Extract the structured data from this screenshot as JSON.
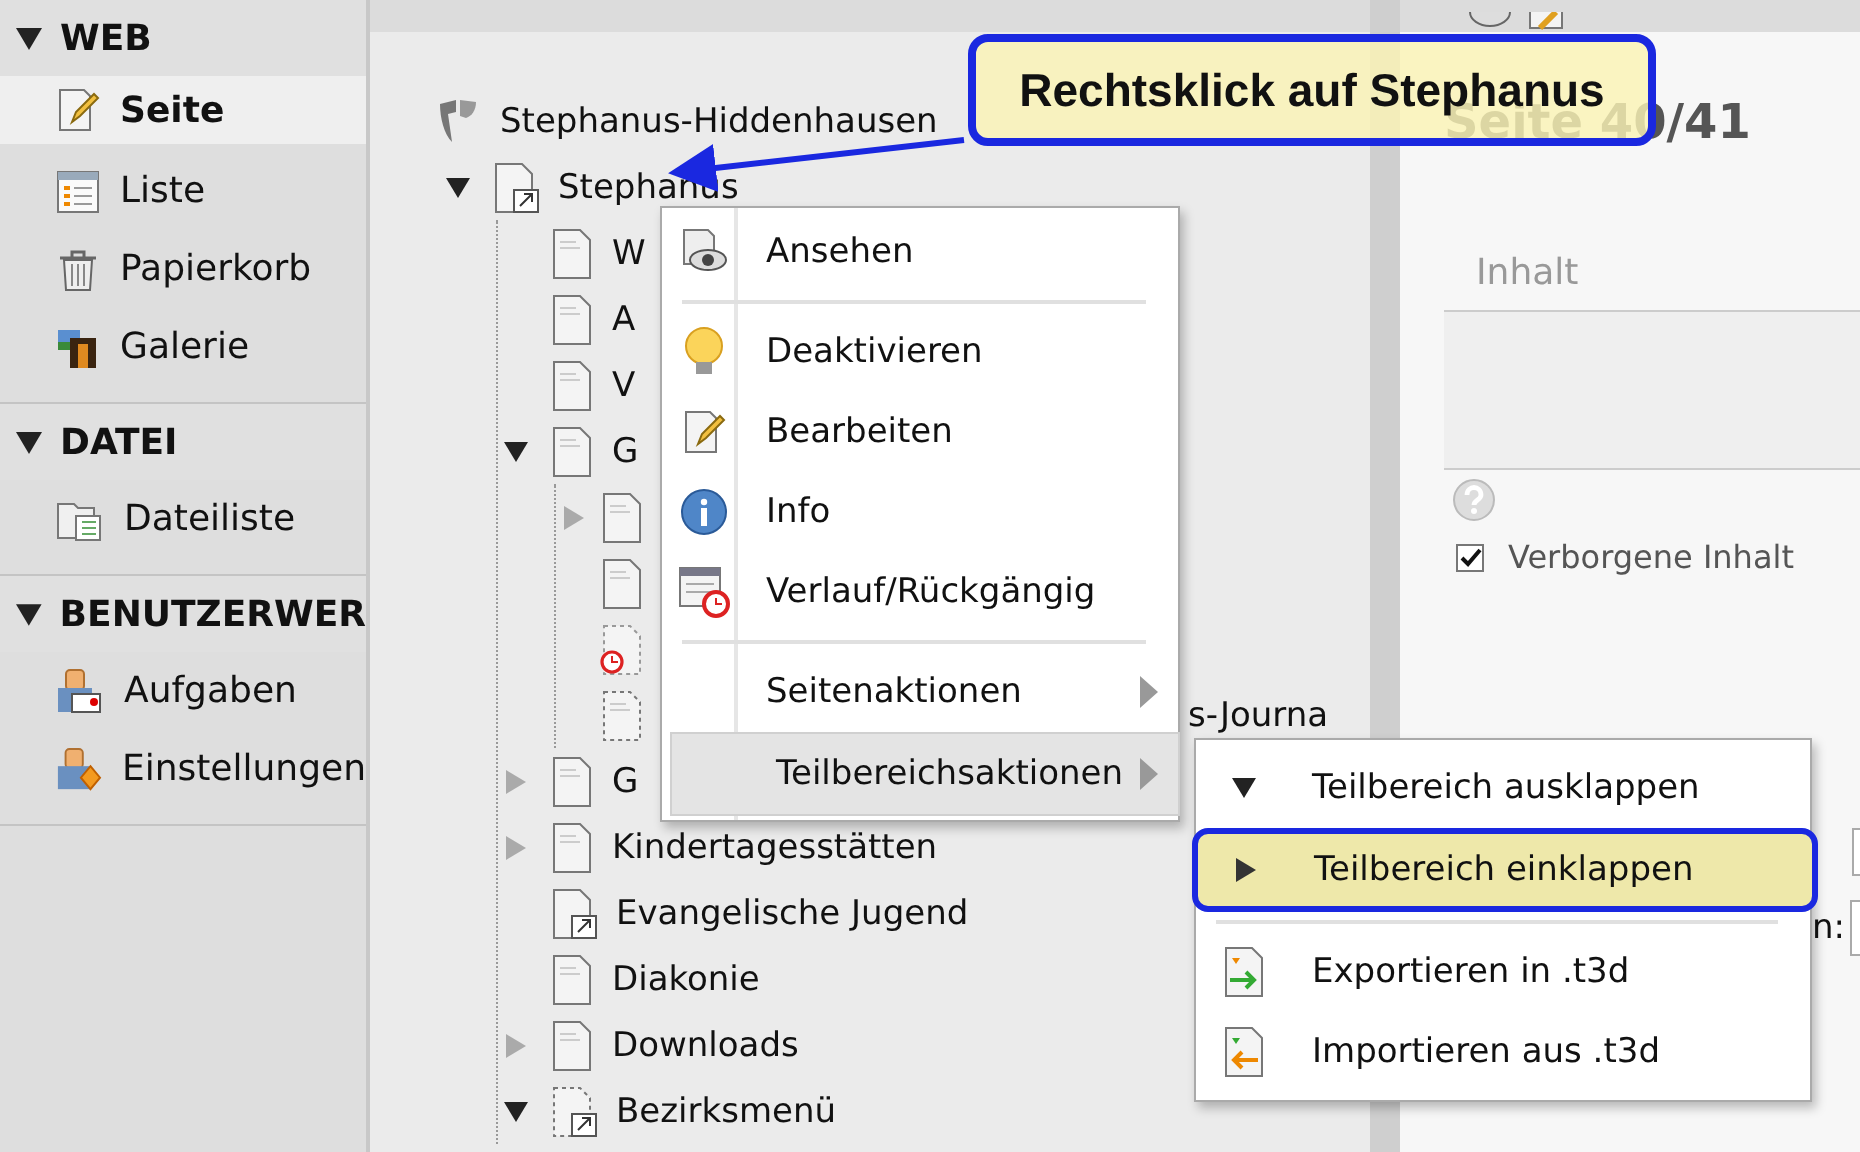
{
  "sidebar": {
    "groups": [
      {
        "title": "WEB",
        "expanded": true,
        "items": [
          {
            "label": "Seite",
            "selected": true
          },
          {
            "label": "Liste",
            "selected": false
          },
          {
            "label": "Papierkorb",
            "selected": false
          },
          {
            "label": "Galerie",
            "selected": false
          }
        ]
      },
      {
        "title": "DATEI",
        "expanded": true,
        "items": [
          {
            "label": "Dateiliste",
            "selected": false
          }
        ]
      },
      {
        "title": "BENUTZERWER",
        "expanded": true,
        "items": [
          {
            "label": "Aufgaben",
            "selected": false
          },
          {
            "label": "Einstellungen",
            "selected": false
          }
        ]
      }
    ]
  },
  "tree": {
    "root": "Stephanus-Hiddenhausen",
    "nodes": [
      {
        "label": "Stephanus",
        "kind": "shortcut",
        "expanded": true,
        "children": [
          {
            "label": "W",
            "kind": "page"
          },
          {
            "label": "A",
            "kind": "page"
          },
          {
            "label": "V",
            "kind": "page"
          },
          {
            "label": "G",
            "kind": "page",
            "expanded": true,
            "children": [
              {
                "kind": "page",
                "expanded": false
              },
              {
                "kind": "page"
              },
              {
                "kind": "scheduled"
              },
              {
                "label": "s-Journa",
                "kind": "hidden"
              }
            ]
          },
          {
            "label": "G",
            "kind": "page",
            "expanded": false
          },
          {
            "label": "Kindertagesstätten",
            "kind": "page",
            "expanded": false
          },
          {
            "label": "Evangelische Jugend",
            "kind": "shortcut"
          },
          {
            "label": "Diakonie",
            "kind": "page"
          },
          {
            "label": "Downloads",
            "kind": "page",
            "expanded": false
          },
          {
            "label": "Bezirksmenü",
            "kind": "hidden-shortcut",
            "expanded": true
          }
        ]
      }
    ]
  },
  "context_menu": {
    "items": [
      {
        "kind": "item",
        "label": "Ansehen",
        "selected": false
      },
      {
        "kind": "separator"
      },
      {
        "kind": "item",
        "label": "Deaktivieren",
        "selected": false
      },
      {
        "kind": "item",
        "label": "Bearbeiten",
        "selected": false
      },
      {
        "kind": "item",
        "label": "Info",
        "selected": false
      },
      {
        "kind": "item",
        "label": "Verlauf/Rückgängig",
        "selected": false
      },
      {
        "kind": "separator"
      },
      {
        "kind": "submenu",
        "label": "Seitenaktionen",
        "selected": false
      },
      {
        "kind": "submenu",
        "label": "Teilbereichsaktionen",
        "selected": true
      }
    ]
  },
  "submenu": {
    "items": [
      {
        "kind": "item",
        "label": "Teilbereich ausklappen",
        "selected": false
      },
      {
        "kind": "item",
        "label": "Teilbereich einklappen",
        "selected": true
      },
      {
        "kind": "separator"
      },
      {
        "kind": "item",
        "label": "Exportieren in .t3d",
        "selected": false
      },
      {
        "kind": "item",
        "label": "Importieren aus .t3d",
        "selected": false
      }
    ]
  },
  "callout": {
    "text": "Rechtsklick auf Stephanus"
  },
  "content": {
    "heading": "Seite 40/41",
    "section": "Inhalt",
    "checkbox": {
      "label": "Verborgene Inhalt",
      "checked": true
    },
    "field_label": "n:"
  }
}
